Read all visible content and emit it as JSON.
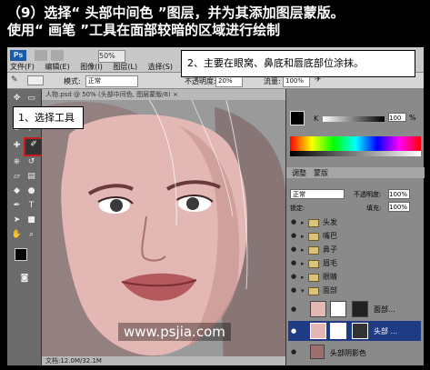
{
  "caption": {
    "line1": "（9）选择“ 头部中间色 ”图层，并为其添加图层蒙版。",
    "line2": "使用“ 画笔 ”工具在面部较暗的区域进行绘制"
  },
  "app": {
    "logo": "Ps",
    "zoom": "50%",
    "menus": [
      "文件(F)",
      "编辑(E)",
      "图像(I)",
      "图层(L)",
      "选择(S)",
      "滤"
    ],
    "options": {
      "mode_label": "模式:",
      "mode_value": "正常",
      "opacity_label": "不透明度:",
      "opacity_value": "20%",
      "flow_label": "流量:",
      "flow_value": "100%"
    },
    "doc_tab": "人物.psd @ 50% (头部中间色, 图层蒙版/8) ×",
    "status": "文档:12.0M/32.1M"
  },
  "callouts": {
    "tool": "1、选择工具",
    "paint": "2、主要在眼窝、鼻底和唇底部位涂抹。"
  },
  "watermark": "www.psjia.com",
  "color_panel": {
    "k_label": "K",
    "k_value": "100",
    "k_unit": "%"
  },
  "layers_panel": {
    "tabs": [
      "调整",
      "蒙版"
    ],
    "blend_mode": "正常",
    "opacity_label": "不透明度:",
    "opacity_value": "100%",
    "lock_label": "锁定:",
    "fill_label": "填充:",
    "fill_value": "100%",
    "groups": [
      "头发",
      "嘴巴",
      "鼻子",
      "眉毛",
      "眼睛",
      "面部"
    ],
    "mask_layer_1": "面部...",
    "mask_layer_2": "头部 ...",
    "bottom_layer": "头部阴影色"
  },
  "colors": {
    "accent_red": "#cc1a1a",
    "selected_row": "#1f3b86",
    "skin": "#e3b7b4"
  }
}
